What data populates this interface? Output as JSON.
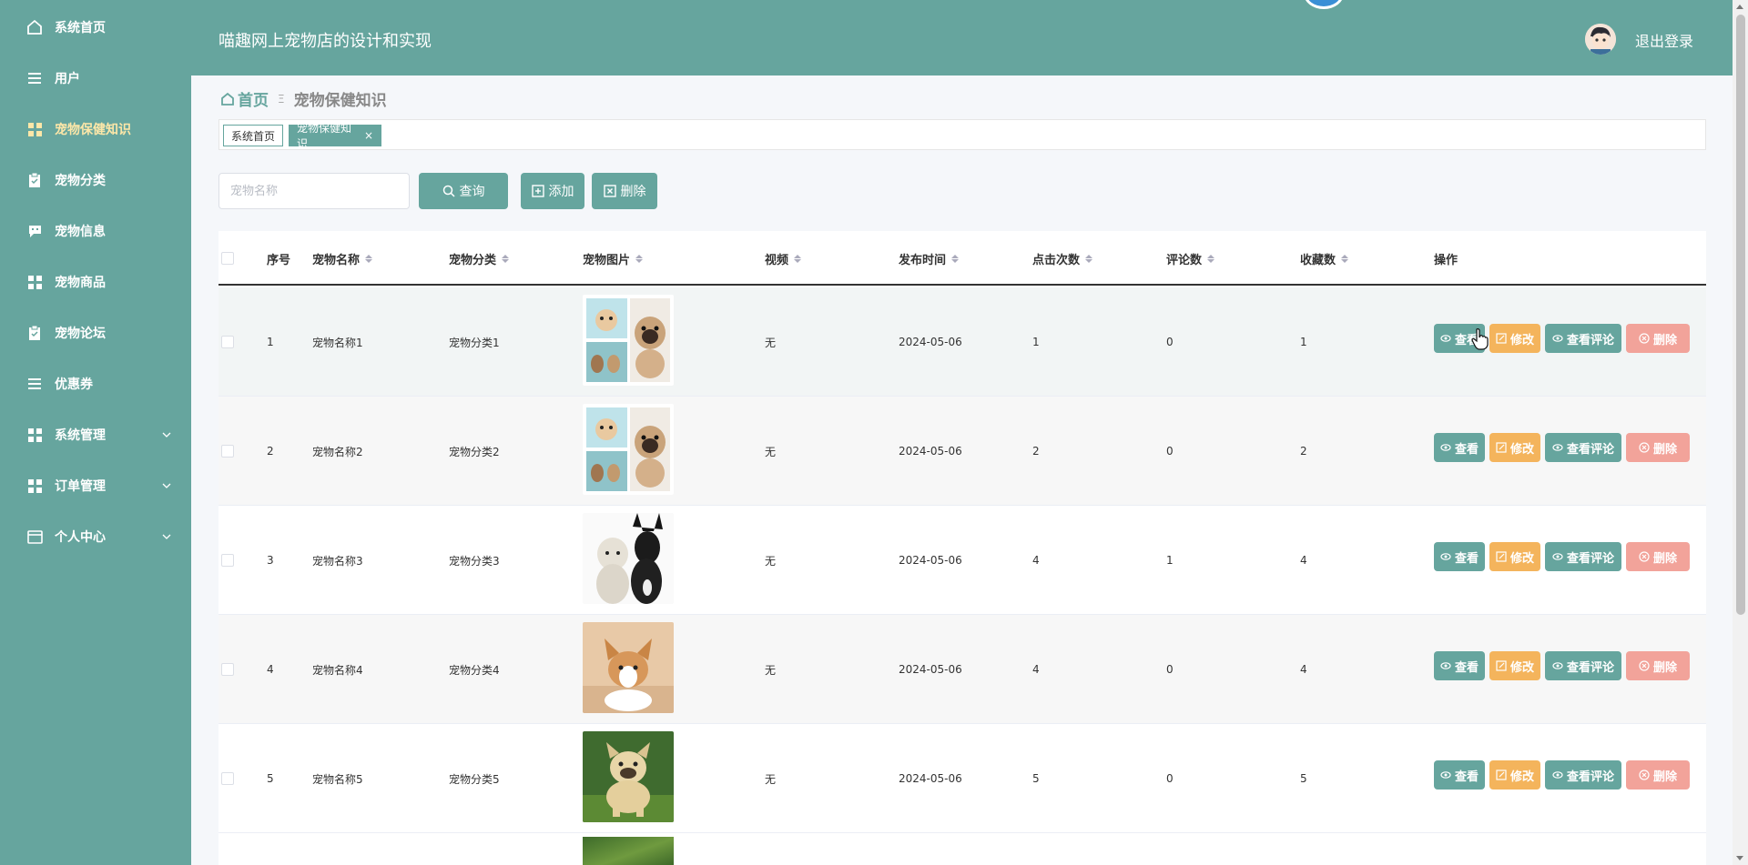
{
  "app": {
    "title": "喵趣网上宠物店的设计和实现",
    "logout": "退出登录"
  },
  "sidebar": {
    "items": [
      {
        "label": "系统首页",
        "icon": "home-icon"
      },
      {
        "label": "用户",
        "icon": "list-icon"
      },
      {
        "label": "宠物保健知识",
        "icon": "grid-icon",
        "active": true
      },
      {
        "label": "宠物分类",
        "icon": "clipboard-icon"
      },
      {
        "label": "宠物信息",
        "icon": "chat-icon"
      },
      {
        "label": "宠物商品",
        "icon": "grid-icon"
      },
      {
        "label": "宠物论坛",
        "icon": "clipboard-icon"
      },
      {
        "label": "优惠券",
        "icon": "list-icon"
      },
      {
        "label": "系统管理",
        "icon": "grid-icon",
        "expandable": true
      },
      {
        "label": "订单管理",
        "icon": "grid-icon",
        "expandable": true
      },
      {
        "label": "个人中心",
        "icon": "wallet-icon",
        "expandable": true
      }
    ]
  },
  "breadcrumb": {
    "home": "首页",
    "separator": "Ξ",
    "current": "宠物保健知识"
  },
  "tabs": {
    "home": "系统首页",
    "active": "宠物保健知识",
    "close": "×"
  },
  "search": {
    "placeholder": "宠物名称",
    "query_label": "查询",
    "add_label": "添加",
    "delete_label": "删除"
  },
  "table": {
    "columns": [
      "序号",
      "宠物名称",
      "宠物分类",
      "宠物图片",
      "视频",
      "发布时间",
      "点击次数",
      "评论数",
      "收藏数",
      "操作"
    ],
    "rows": [
      {
        "index": "1",
        "name": "宠物名称1",
        "category": "宠物分类1",
        "video": "无",
        "date": "2024-05-06",
        "clicks": "1",
        "comments": "0",
        "favorites": "1",
        "image": "collage"
      },
      {
        "index": "2",
        "name": "宠物名称2",
        "category": "宠物分类2",
        "video": "无",
        "date": "2024-05-06",
        "clicks": "2",
        "comments": "0",
        "favorites": "2",
        "image": "collage"
      },
      {
        "index": "3",
        "name": "宠物名称3",
        "category": "宠物分类3",
        "video": "无",
        "date": "2024-05-06",
        "clicks": "4",
        "comments": "1",
        "favorites": "4",
        "image": "dogs-pair"
      },
      {
        "index": "4",
        "name": "宠物名称4",
        "category": "宠物分类4",
        "video": "无",
        "date": "2024-05-06",
        "clicks": "4",
        "comments": "0",
        "favorites": "4",
        "image": "corgi"
      },
      {
        "index": "5",
        "name": "宠物名称5",
        "category": "宠物分类5",
        "video": "无",
        "date": "2024-05-06",
        "clicks": "5",
        "comments": "0",
        "favorites": "5",
        "image": "bulldog"
      }
    ],
    "actions": {
      "view": "查看",
      "edit": "修改",
      "comments": "查看评论",
      "delete": "删除"
    }
  },
  "colors": {
    "primary": "#66a59e",
    "active_menu": "#fde7a8",
    "edit": "#f4b45c",
    "delete": "#f2a39a"
  }
}
